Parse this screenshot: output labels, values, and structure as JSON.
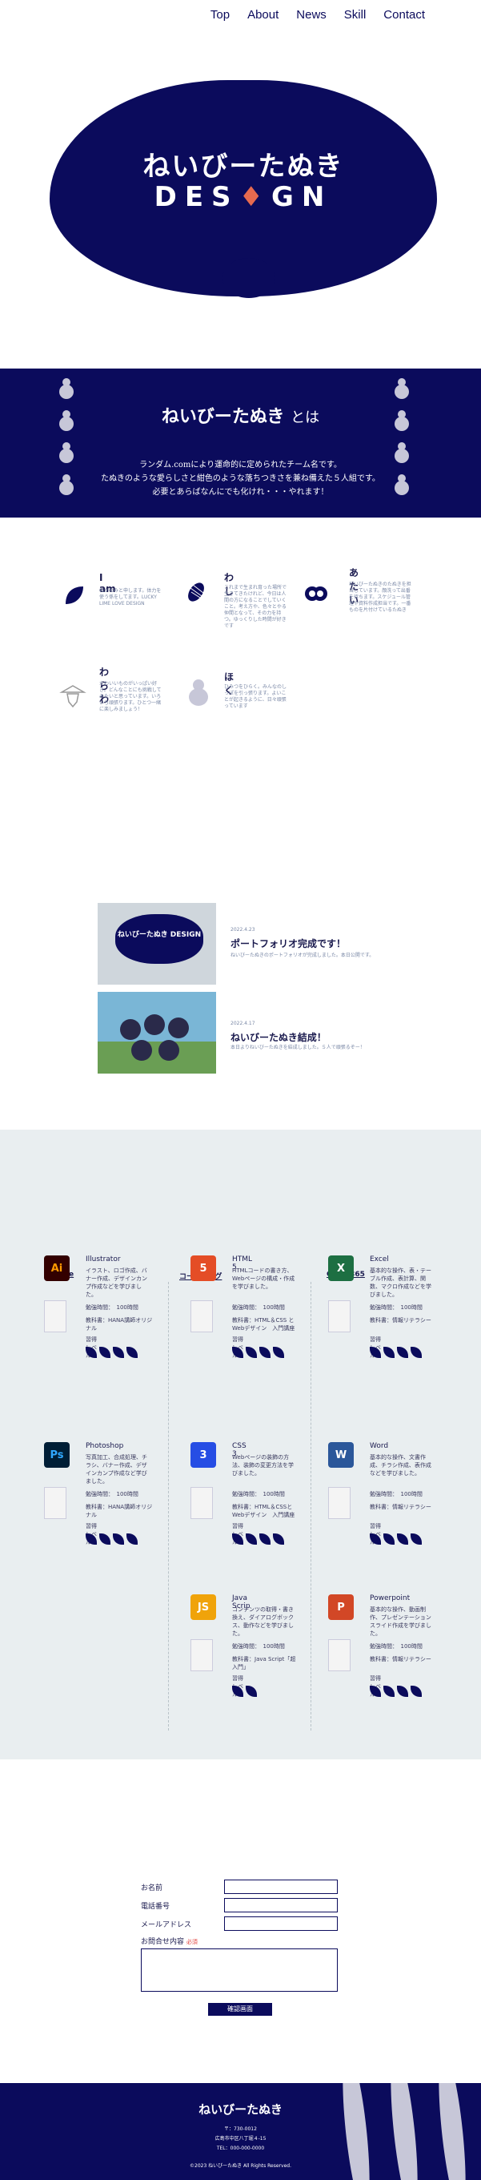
{
  "nav": {
    "items": [
      "Top",
      "About",
      "News",
      "Skill",
      "Contact"
    ]
  },
  "hero": {
    "title": "ねいびーたぬき",
    "subtitle_pre": "DES",
    "subtitle_mark": "♦",
    "subtitle_post": "GN"
  },
  "about": {
    "title": "ねいびーたぬき",
    "title_suffix": "とは",
    "lines": [
      "ランダム.comにより運命的に定められたチーム名です。",
      "たぬきのような愛らしさと紺色のような落ちつきさを兼ね備えた５人組です。",
      "必要とあらばなんにでも化けれ・・・やれます！"
    ]
  },
  "members": [
    {
      "name": "I am",
      "desc": "ねかのみと申します。体力を使う係をしてます。LUCKY LIME LOVE DESIGN"
    },
    {
      "name": "わし",
      "desc": "これまで生まれ育った場所で生きてきたけれど、今日は人間の方になることでしていくこと。考え方や、色々とやる仲間となって、その力を持つ。ゆっくりした時間が好きです"
    },
    {
      "name": "あたい",
      "desc": "ねいびーたぬきのたぬきを担当しています。顔洗って出番を待ちます。スケジュール管理や資料作成担当です。一番ものを片付けているたぬき"
    },
    {
      "name": "わらわ",
      "desc": "かわいいものがいっぱい好き。どんなことにも挑戦してみたいと思っています。いろいろ頑張ります。ひとつ一緒に楽しみましょう！"
    },
    {
      "name": "ほく",
      "desc": "ひみつをひらく。みんなのしっぽを引っ張ります。よいことが起きるように、日々頑張っています"
    }
  ],
  "posts": [
    {
      "date": "2022.4.23",
      "title": "ポートフォリオ完成です！",
      "desc": "ねいびーたぬきのポートフォリオが完成しました。本日公開です。",
      "img_text": "ねいびーたぬき DESIGN"
    },
    {
      "date": "2022.4.17",
      "title": "ねいびーたぬき結成！",
      "desc": "本日よりねいびーたぬきを結成しました。５人で頑張るぞー！",
      "img_text": ""
    }
  ],
  "skills": {
    "columns": [
      "Adobe",
      "コーディング",
      "Office365"
    ],
    "items": [
      {
        "name": "Illustrator",
        "icon": "Ai",
        "color": "#330000",
        "fg": "#ff9a00",
        "text": "イラスト、ロゴ作成、バナー作成、デザインカンプ作成などを学びました。",
        "time": "勉強時間：　100時間",
        "book": "教科書：HANA講師オリジナル",
        "level_label": "習得レベル：",
        "level": 4
      },
      {
        "name": "Photoshop",
        "icon": "Ps",
        "color": "#001e36",
        "fg": "#31a8ff",
        "text": "写真加工、合成処理、チラシ、バナー作成、デザインカンプ作成など学びました。",
        "time": "勉強時間：　100時間",
        "book": "教科書：HANA講師オリジナル",
        "level_label": "習得レベル：",
        "level": 4
      },
      {
        "name": "HTML 5",
        "icon": "5",
        "color": "#e44d26",
        "fg": "#ffffff",
        "text": "HTMLコードの書き方、Webページの構成・作成を学びました。",
        "time": "勉強時間：　100時間",
        "book": "教科書：HTML＆CSS とWebデザイン　入門講座",
        "level_label": "習得レベル：",
        "level": 4
      },
      {
        "name": "CSS 3",
        "icon": "3",
        "color": "#264de4",
        "fg": "#ffffff",
        "text": "Webページの装飾の方法、装飾の変更方法を学びました。",
        "time": "勉強時間：　100時間",
        "book": "教科書：HTML＆CSSとWebデザイン　入門講座",
        "level_label": "習得レベル：",
        "level": 4
      },
      {
        "name": "Java Scrip",
        "icon": "JS",
        "color": "#f0a30a",
        "fg": "#ffffff",
        "text": "コンテンツの取得・書き換え、ダイアログボックス、動作などを学びました。",
        "time": "勉強時間：　100時間",
        "book": "教科書：Java Script「超入門」",
        "level_label": "習得レベル：",
        "level": 2
      },
      {
        "name": "Excel",
        "icon": "X",
        "color": "#1d6f42",
        "fg": "#ffffff",
        "text": "基本的な操作、表・テーブル作成、表計算、関数、マクロ作成などを学びました。",
        "time": "勉強時間：　100時間",
        "book": "教科書：情報リテラシー",
        "level_label": "習得レベル：",
        "level": 4
      },
      {
        "name": "Word",
        "icon": "W",
        "color": "#2b579a",
        "fg": "#ffffff",
        "text": "基本的な操作、文書作成、チラシ作成、表作成などを学びました。",
        "time": "勉強時間：　100時間",
        "book": "教科書：情報リテラシー",
        "level_label": "習得レベル：",
        "level": 4
      },
      {
        "name": "Powerpoint",
        "icon": "P",
        "color": "#d24726",
        "fg": "#ffffff",
        "text": "基本的な操作、動画制作、プレゼンテーションスライド作成を学びました。",
        "time": "勉強時間：　100時間",
        "book": "教科書：情報リテラシー",
        "level_label": "習得レベル：",
        "level": 4
      }
    ]
  },
  "contact": {
    "name_label": "お名前",
    "phone_label": "電話番号",
    "email_label": "メールアドレス",
    "message_label": "お問合せ内容",
    "required": "必須",
    "submit": "確認画面"
  },
  "footer": {
    "title": "ねいびーたぬき",
    "zip": "〒：730-0012",
    "address": "広島市中区八丁堀４-15",
    "tel": "TEL：000-000-0000",
    "copyright": "©2023 ねいびーたぬき All Rights Reserved."
  }
}
